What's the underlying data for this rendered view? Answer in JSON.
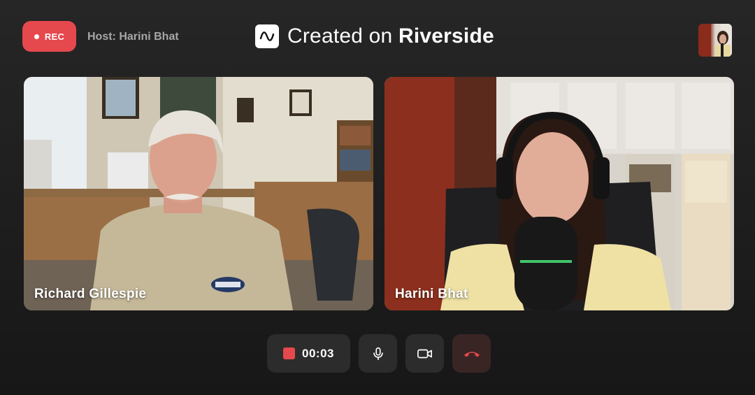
{
  "header": {
    "rec_label": "REC",
    "host_label": "Host: Harini Bhat",
    "brand_prefix": "Created on",
    "brand_name": "Riverside"
  },
  "participants": [
    {
      "name": "Richard Gillespie"
    },
    {
      "name": "Harini Bhat"
    }
  ],
  "controls": {
    "timer": "00:03",
    "icons": [
      "stop-recording-icon",
      "microphone-icon",
      "video-camera-icon",
      "end-call-icon"
    ]
  },
  "colors": {
    "rec_red": "#e5484d",
    "background": "#1b1b1b",
    "control_bg": "#2c2c2c",
    "end_call_red": "#e5484d"
  }
}
